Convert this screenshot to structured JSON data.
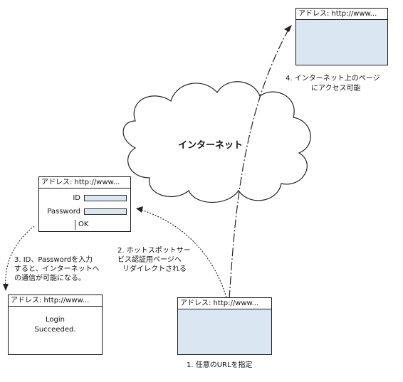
{
  "window_top": {
    "title": "アドレス: http://www..."
  },
  "window_login": {
    "title": "アドレス: http://www...",
    "id_label": "ID",
    "password_label": "Password",
    "ok_label": "OK"
  },
  "window_success": {
    "title": "アドレス: http://www...",
    "message_line1": "Login",
    "message_line2": "Succeeded."
  },
  "window_user": {
    "title": "アドレス: http://www..."
  },
  "cloud": {
    "label": "インターネット"
  },
  "captions": {
    "step1": "1. 任意のURLを指定",
    "step2_line1": "2. ホットスポットサー",
    "step2_line2": "ビス認証用ページへ",
    "step2_line3": "リダイレクトされる",
    "step3_line1": "3. ID、Passwordを入力",
    "step3_line2": "すると、インターネットへ",
    "step3_line3": "の通信が可能になる。",
    "step4_line1": "4. インターネット上のページ",
    "step4_line2": "にアクセス可能"
  }
}
